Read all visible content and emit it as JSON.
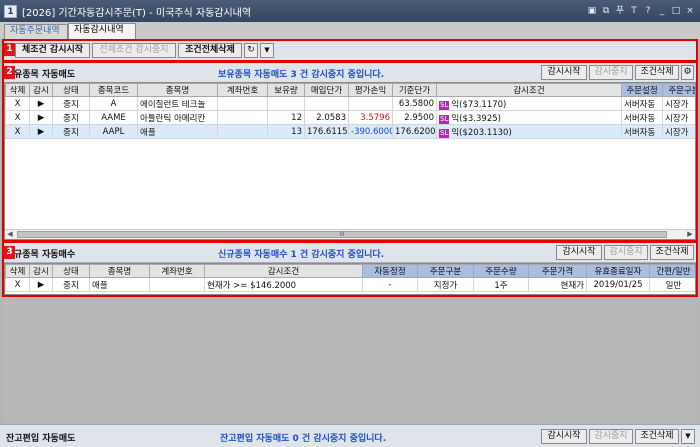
{
  "window": {
    "icon": "1",
    "title": "[2026] 기간자동감시주문(T) - 미국주식 자동감시내역",
    "controls": [
      "▣",
      "⧉",
      "푸",
      "T",
      "?",
      "_",
      "□",
      "×"
    ]
  },
  "tabs": [
    {
      "label": "자동주문내역"
    },
    {
      "label": "자동감시내역"
    }
  ],
  "toolbar": {
    "number": "1",
    "btn_start_partial": "체조건 감시시작",
    "btn_stop_all": "전체조건 감시중지",
    "btn_delete_all": "조건전체삭제",
    "refresh_icon": "↻",
    "dropdown_icon": "▼"
  },
  "sec2": {
    "number": "2",
    "label_partial": "유종목 자동매도",
    "message": "보유종목 자동매도 3 건 감시중지 중입니다.",
    "btn_start": "감시시작",
    "btn_stop": "감시중지",
    "btn_delete": "조건삭제",
    "gear_icon": "⚙",
    "columns": [
      "삭제",
      "감시",
      "상태",
      "종목코드",
      "종목명",
      "계좌번호",
      "보유량",
      "매입단가",
      "평가손익",
      "기준단가",
      "감시조건",
      "주문설정",
      "주문구분"
    ],
    "rows": [
      {
        "del": "X",
        "play": "▶",
        "status": "중지",
        "code": "A",
        "name": "에이질런트 테크놀",
        "acct": "",
        "qty": "",
        "buy": "",
        "pl": "",
        "base": "63.5800",
        "badge": "SL",
        "cond": "익($73.1170)",
        "order": "서버자동",
        "kind": "시장가"
      },
      {
        "del": "X",
        "play": "▶",
        "status": "중지",
        "code": "AAME",
        "name": "아틀란틱 아메리칸",
        "acct": "",
        "qty": "12",
        "buy": "2.0583",
        "pl": "3.5796",
        "base": "2.9500",
        "badge": "SL",
        "cond": "익($3.3925)",
        "order": "서버자동",
        "kind": "시장가"
      },
      {
        "del": "X",
        "play": "▶",
        "status": "중지",
        "code": "AAPL",
        "name": "애플",
        "acct": "",
        "qty": "13",
        "buy": "176.6115",
        "pl": "-390.6000",
        "base": "176.6200",
        "badge": "SL",
        "cond": "익($203.1130)",
        "order": "서버자동",
        "kind": "시장가"
      }
    ],
    "scroll_mark": "III"
  },
  "sec3": {
    "number": "3",
    "label": "규종목 자동매수",
    "message": "신규종목 자동매수 1 건 감시중지 중입니다.",
    "btn_start": "감시시작",
    "btn_stop": "감시중지",
    "btn_delete": "조건삭제",
    "columns": [
      "삭제",
      "감시",
      "상태",
      "종목명",
      "계좌번호",
      "감시조건",
      "자동정정",
      "주문구분",
      "주문수량",
      "주문가격",
      "유효종료일자",
      "간편/일반"
    ],
    "rows": [
      {
        "del": "X",
        "play": "▶",
        "status": "중지",
        "name": "애플",
        "acct": "",
        "cond": "현재가 >= $146.2000",
        "auto": "-",
        "kind": "지정가",
        "qty": "1주",
        "price": "현재가",
        "end": "2019/01/25",
        "mode": "일반"
      }
    ]
  },
  "sec4": {
    "label": "잔고편입 자동매도",
    "message": "잔고편입 자동매도 0 건 감시중지 중입니다.",
    "btn_start": "감시시작",
    "btn_stop": "감시중지",
    "btn_delete": "조건삭제",
    "dropdown_icon": "▼"
  }
}
